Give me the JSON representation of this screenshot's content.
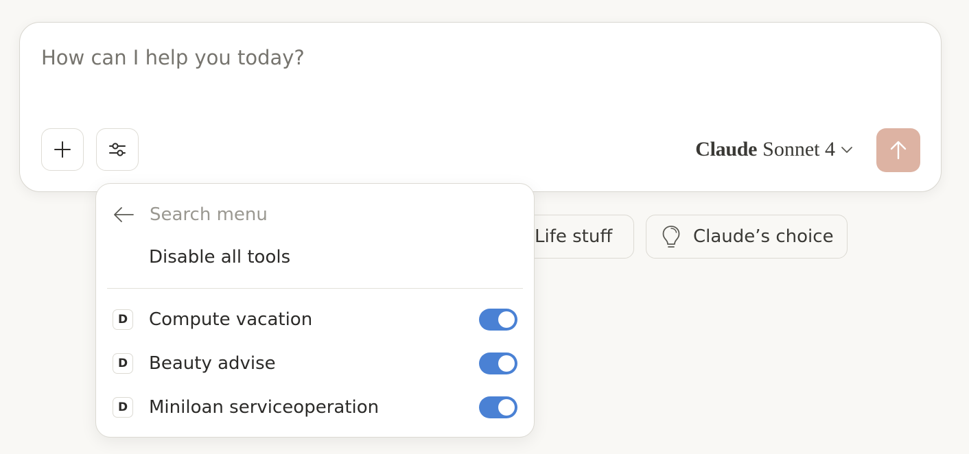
{
  "composer": {
    "placeholder": "How can I help you today?",
    "model": {
      "brand": "Claude",
      "name": "Sonnet 4"
    }
  },
  "menu": {
    "search_placeholder": "Search menu",
    "disable_all": "Disable all tools",
    "tools": [
      {
        "badge": "D",
        "label": "Compute vacation",
        "enabled": true
      },
      {
        "badge": "D",
        "label": "Beauty advise",
        "enabled": true
      },
      {
        "badge": "D",
        "label": "Miniloan serviceoperation",
        "enabled": true
      }
    ]
  },
  "suggestions": [
    {
      "label": "Life stuff"
    },
    {
      "label": "Claude’s choice",
      "icon": "lightbulb-icon"
    }
  ],
  "colors": {
    "background": "#f9f8f5",
    "send_button": "#ddb3a3",
    "toggle_on": "#4a81d4"
  }
}
